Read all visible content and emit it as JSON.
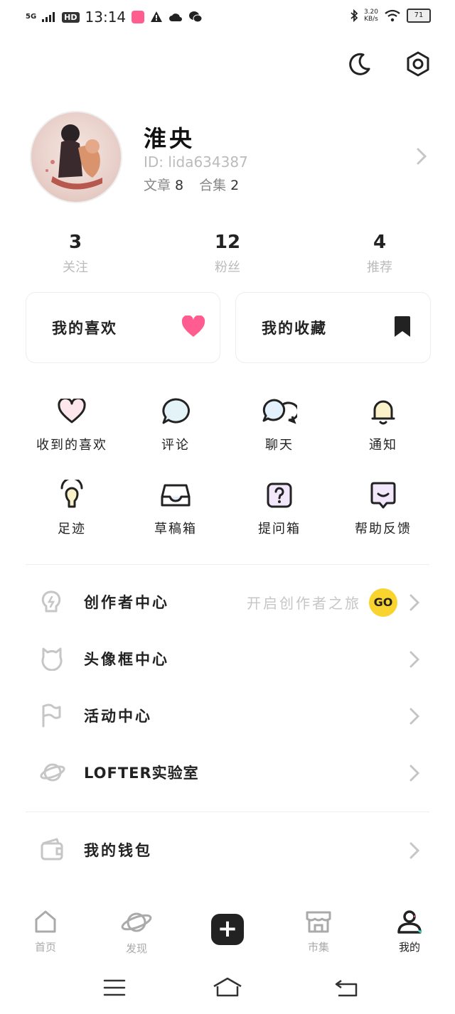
{
  "status_bar": {
    "network": "5G",
    "hd": "HD",
    "time": "13:14",
    "speed_value": "3.20",
    "speed_unit": "KB/s",
    "battery": "71"
  },
  "profile": {
    "name": "淮央",
    "id_label": "ID: lida634387",
    "articles_label": "文章",
    "articles_count": "8",
    "collections_label": "合集",
    "collections_count": "2"
  },
  "stats": [
    {
      "value": "3",
      "label": "关注"
    },
    {
      "value": "12",
      "label": "粉丝"
    },
    {
      "value": "4",
      "label": "推荐"
    }
  ],
  "cards": {
    "likes": "我的喜欢",
    "favorites": "我的收藏"
  },
  "grid": [
    {
      "label": "收到的喜欢",
      "icon": "heart-outline-icon"
    },
    {
      "label": "评论",
      "icon": "comment-bubble-icon"
    },
    {
      "label": "聊天",
      "icon": "chat-bubbles-icon"
    },
    {
      "label": "通知",
      "icon": "bell-icon"
    },
    {
      "label": "足迹",
      "icon": "footprint-bulb-icon"
    },
    {
      "label": "草稿箱",
      "icon": "inbox-tray-icon"
    },
    {
      "label": "提问箱",
      "icon": "question-box-icon"
    },
    {
      "label": "帮助反馈",
      "icon": "feedback-icon"
    }
  ],
  "menu": [
    {
      "label": "创作者中心",
      "icon": "lightbulb-icon",
      "sub": "开启创作者之旅",
      "badge": "GO"
    },
    {
      "label": "头像框中心",
      "icon": "avatar-frame-icon"
    },
    {
      "label": "活动中心",
      "icon": "flag-icon"
    },
    {
      "label": "LOFTER实验室",
      "icon": "planet-icon"
    }
  ],
  "wallet": {
    "label": "我的钱包",
    "icon": "wallet-icon"
  },
  "tabs": [
    {
      "label": "首页",
      "icon": "home-icon"
    },
    {
      "label": "发现",
      "icon": "planet-icon"
    },
    {
      "label": "市集",
      "icon": "shop-icon"
    },
    {
      "label": "我的",
      "icon": "user-icon",
      "active": true
    }
  ],
  "colors": {
    "accent_pink": "#ff5d8f",
    "go_badge": "#f9d42f",
    "text_dark": "#222222",
    "text_muted": "#bbbbbb"
  }
}
